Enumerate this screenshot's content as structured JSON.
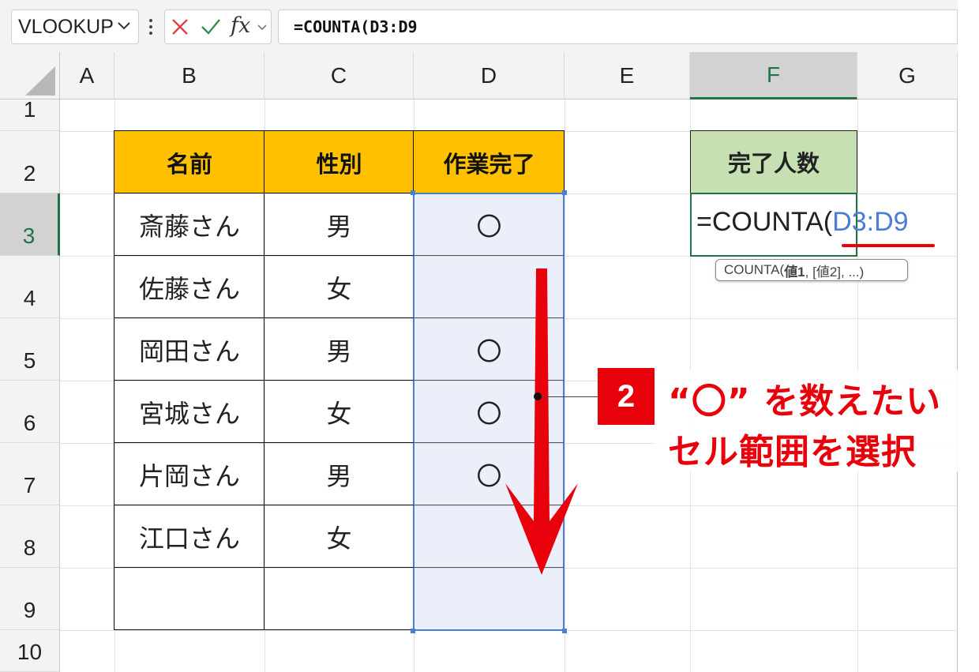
{
  "formula_bar": {
    "name_box": "VLOOKUP",
    "fx_label": "fx",
    "formula": "=COUNTA(D3:D9"
  },
  "columns": [
    "A",
    "B",
    "C",
    "D",
    "E",
    "F",
    "G"
  ],
  "rows": [
    "1",
    "2",
    "3",
    "4",
    "5",
    "6",
    "7",
    "8",
    "9",
    "10"
  ],
  "selected_column": "F",
  "selected_row": "3",
  "table": {
    "headers": [
      "名前",
      "性別",
      "作業完了"
    ],
    "rows": [
      [
        "斎藤さん",
        "男",
        "〇"
      ],
      [
        "佐藤さん",
        "女",
        ""
      ],
      [
        "岡田さん",
        "男",
        "〇"
      ],
      [
        "宮城さん",
        "女",
        "〇"
      ],
      [
        "片岡さん",
        "男",
        "〇"
      ],
      [
        "江口さん",
        "女",
        ""
      ],
      [
        "",
        "",
        ""
      ]
    ]
  },
  "result": {
    "header": "完了人数",
    "formula_prefix": "=COUNTA(",
    "formula_ref": "D3:D9",
    "tooltip_func": "COUNTA(",
    "tooltip_arg1": "値1",
    "tooltip_rest": ", [値2], ...)"
  },
  "annotation": {
    "step": "2",
    "line1": "“〇” を数えたい",
    "line2": "セル範囲を選択"
  },
  "colors": {
    "header_fill": "#ffc000",
    "result_header_fill": "#c6e0b4",
    "selection_border": "#4a7dd3",
    "accent_red": "#e8000b",
    "excel_green": "#217346"
  }
}
